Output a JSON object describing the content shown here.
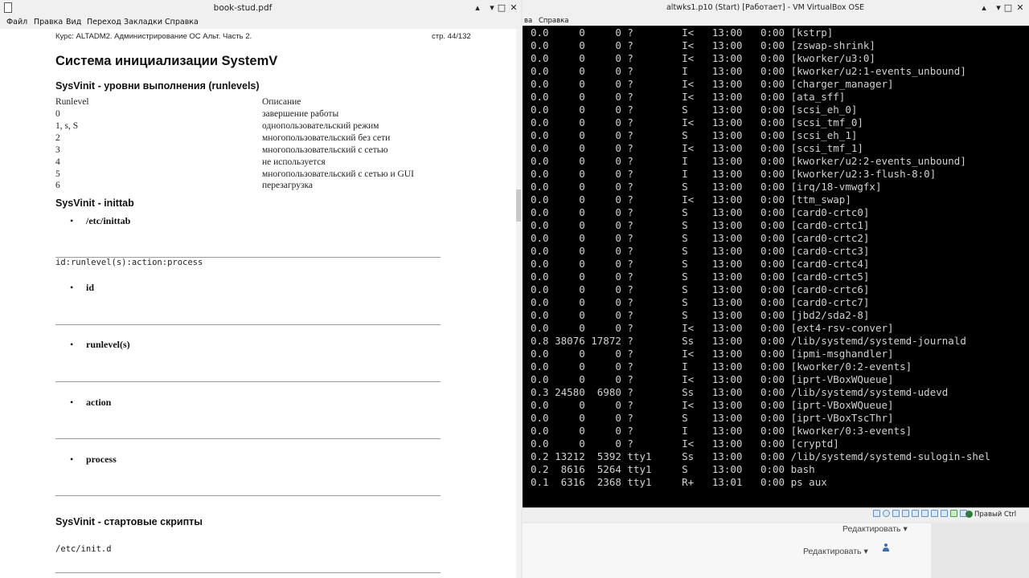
{
  "pdf_window": {
    "title": "book-stud.pdf",
    "controls": {
      "restore": "▴",
      "minimize": "▾",
      "maximize": "□",
      "close": "✕"
    },
    "menu": [
      "Файл",
      "Правка",
      "Вид",
      "Переход",
      "Закладки",
      "Справка"
    ],
    "page": {
      "course_header": "Курс: ALTADM2. Администрирование ОС Альт. Часть 2.",
      "page_number": "стр. 44/132",
      "title": "Система инициализации SystemV",
      "runlevels_heading": "SysVinit - уровни выполнения (runlevels)",
      "runlevels_table": {
        "headers": [
          "Runlevel",
          "Описание"
        ],
        "rows": [
          [
            "0",
            "завершение работы"
          ],
          [
            "1, s, S",
            "однопользовательский режим"
          ],
          [
            "2",
            "многопользовательский без сети"
          ],
          [
            "3",
            "многопользовательский с сетью"
          ],
          [
            "4",
            "не используется"
          ],
          [
            "5",
            "многопользовательский с сетью и GUI"
          ],
          [
            "6",
            "перезагрузка"
          ]
        ]
      },
      "inittab_heading": "SysVinit - inittab",
      "inittab_bullet": "/etc/inittab",
      "inittab_format": "id:runlevel(s):action:process",
      "fields": [
        "id",
        "runlevel(s)",
        "action",
        "process"
      ],
      "scripts_heading": "SysVinit - стартовые скрипты",
      "scripts_path": "/etc/init.d"
    }
  },
  "vm_window": {
    "title": "altwks1.p10 (Start) [Работает] - VM VirtualBox OSE",
    "controls": {
      "restore": "▴",
      "minimize": "▾",
      "maximize": "□",
      "close": "✕"
    },
    "menu": [
      "ва",
      "Справка"
    ],
    "terminal_lines": [
      "0.0     0     0 ?        I<   13:00   0:00 [kstrp]",
      "0.0     0     0 ?        I<   13:00   0:00 [zswap-shrink]",
      "0.0     0     0 ?        I<   13:00   0:00 [kworker/u3:0]",
      "0.0     0     0 ?        I    13:00   0:00 [kworker/u2:1-events_unbound]",
      "0.0     0     0 ?        I<   13:00   0:00 [charger_manager]",
      "0.0     0     0 ?        I<   13:00   0:00 [ata_sff]",
      "0.0     0     0 ?        S    13:00   0:00 [scsi_eh_0]",
      "0.0     0     0 ?        I<   13:00   0:00 [scsi_tmf_0]",
      "0.0     0     0 ?        S    13:00   0:00 [scsi_eh_1]",
      "0.0     0     0 ?        I<   13:00   0:00 [scsi_tmf_1]",
      "0.0     0     0 ?        I    13:00   0:00 [kworker/u2:2-events_unbound]",
      "0.0     0     0 ?        I    13:00   0:00 [kworker/u2:3-flush-8:0]",
      "0.0     0     0 ?        S    13:00   0:00 [irq/18-vmwgfx]",
      "0.0     0     0 ?        I<   13:00   0:00 [ttm_swap]",
      "0.0     0     0 ?        S    13:00   0:00 [card0-crtc0]",
      "0.0     0     0 ?        S    13:00   0:00 [card0-crtc1]",
      "0.0     0     0 ?        S    13:00   0:00 [card0-crtc2]",
      "0.0     0     0 ?        S    13:00   0:00 [card0-crtc3]",
      "0.0     0     0 ?        S    13:00   0:00 [card0-crtc4]",
      "0.0     0     0 ?        S    13:00   0:00 [card0-crtc5]",
      "0.0     0     0 ?        S    13:00   0:00 [card0-crtc6]",
      "0.0     0     0 ?        S    13:00   0:00 [card0-crtc7]",
      "0.0     0     0 ?        S    13:00   0:00 [jbd2/sda2-8]",
      "0.0     0     0 ?        I<   13:00   0:00 [ext4-rsv-conver]",
      "0.8 38076 17872 ?        Ss   13:00   0:00 /lib/systemd/systemd-journald",
      "0.0     0     0 ?        I<   13:00   0:00 [ipmi-msghandler]",
      "0.0     0     0 ?        I    13:00   0:00 [kworker/0:2-events]",
      "0.0     0     0 ?        I<   13:00   0:00 [iprt-VBoxWQueue]",
      "0.3 24580  6980 ?        Ss   13:00   0:00 /lib/systemd/systemd-udevd",
      "0.0     0     0 ?        I<   13:00   0:00 [iprt-VBoxWQueue]",
      "0.0     0     0 ?        S    13:00   0:00 [iprt-VBoxTscThr]",
      "0.0     0     0 ?        I    13:00   0:00 [kworker/0:3-events]",
      "0.0     0     0 ?        I<   13:00   0:00 [cryptd]",
      "0.2 13212  5392 tty1     Ss   13:00   0:00 /lib/systemd/systemd-sulogin-shel",
      "0.2  8616  5264 tty1     S    13:00   0:00 bash",
      "0.1  6316  2368 tty1     R+   13:01   0:00 ps aux"
    ],
    "host_key": "Правый Ctrl",
    "status_icons": [
      "hdd-icon",
      "optical-icon",
      "audio-icon",
      "network-icon",
      "usb-icon",
      "shared-folder-icon",
      "display-icon",
      "recording-icon",
      "capture-icon",
      "mouse-integration-icon",
      "host-key-icon"
    ]
  },
  "background_window": {
    "edit_label_1": "Редактировать ▾",
    "edit_label_2": "Редактировать ▾"
  }
}
